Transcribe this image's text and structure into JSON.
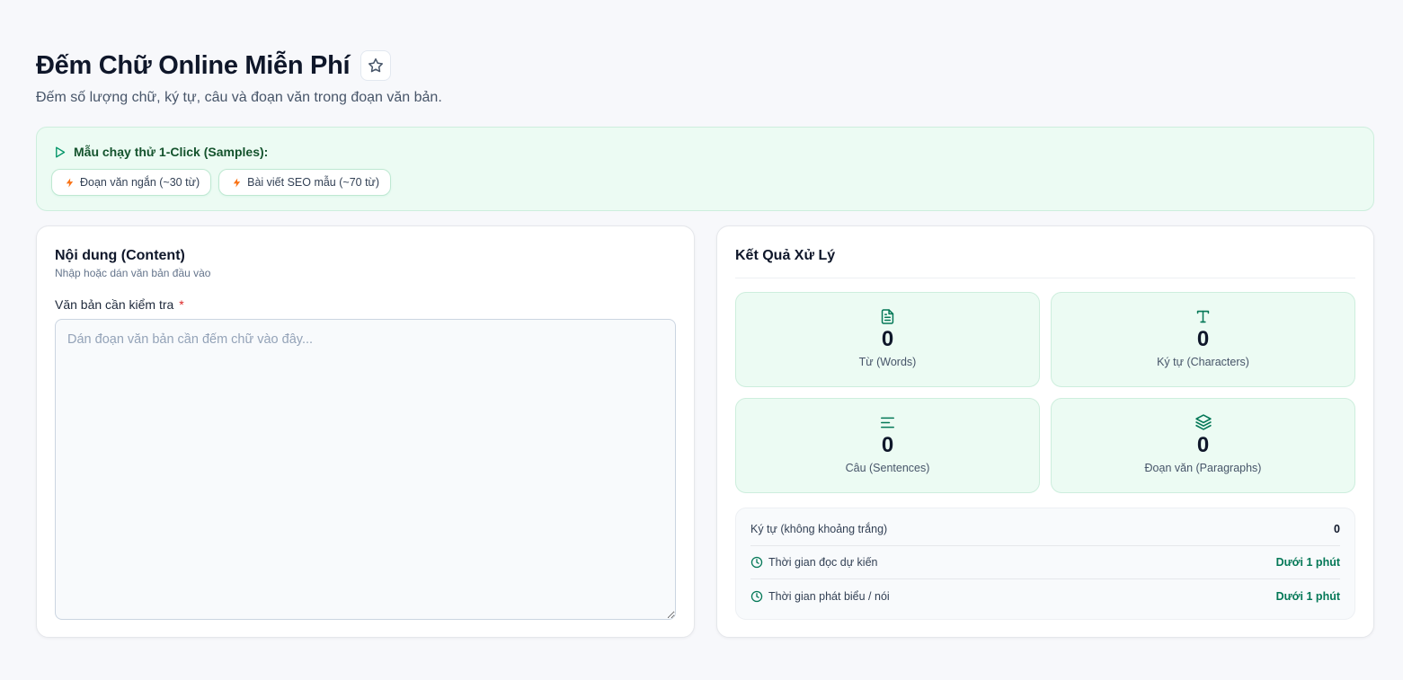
{
  "header": {
    "title": "Đếm Chữ Online Miễn Phí",
    "subtitle": "Đếm số lượng chữ, ký tự, câu và đoạn văn trong đoạn văn bản.",
    "favorite_icon": "star-icon"
  },
  "samples": {
    "title": "Mẫu chạy thử 1-Click (Samples):",
    "chips": [
      {
        "label": "Đoạn văn ngắn (~30 từ)",
        "icon": "bolt-icon"
      },
      {
        "label": "Bài viết SEO mẫu (~70 từ)",
        "icon": "bolt-icon"
      }
    ]
  },
  "input_panel": {
    "title": "Nội dung (Content)",
    "subtitle": "Nhập hoặc dán văn bản đầu vào",
    "field_label": "Văn bản cần kiểm tra",
    "required_mark": "*",
    "placeholder": "Dán đoạn văn bản cần đếm chữ vào đây...",
    "value": ""
  },
  "results": {
    "title": "Kết Quả Xử Lý",
    "stats": [
      {
        "label": "Từ (Words)",
        "value": "0",
        "icon": "document-icon"
      },
      {
        "label": "Ký tự (Characters)",
        "value": "0",
        "icon": "type-icon"
      },
      {
        "label": "Câu (Sentences)",
        "value": "0",
        "icon": "text-lines-icon"
      },
      {
        "label": "Đoạn văn (Paragraphs)",
        "value": "0",
        "icon": "layers-icon"
      }
    ],
    "details": [
      {
        "label": "Ký tự (không khoảng trắng)",
        "value": "0"
      },
      {
        "label": "Thời gian đọc dự kiến",
        "value": "Dưới 1 phút",
        "icon": "clock-icon"
      },
      {
        "label": "Thời gian phát biểu / nói",
        "value": "Dưới 1 phút",
        "icon": "clock-icon"
      }
    ]
  },
  "colors": {
    "accent": "#047857",
    "accent_soft": "#ecfbf3",
    "chip_icon": "#f97316",
    "required": "#dc2626"
  }
}
